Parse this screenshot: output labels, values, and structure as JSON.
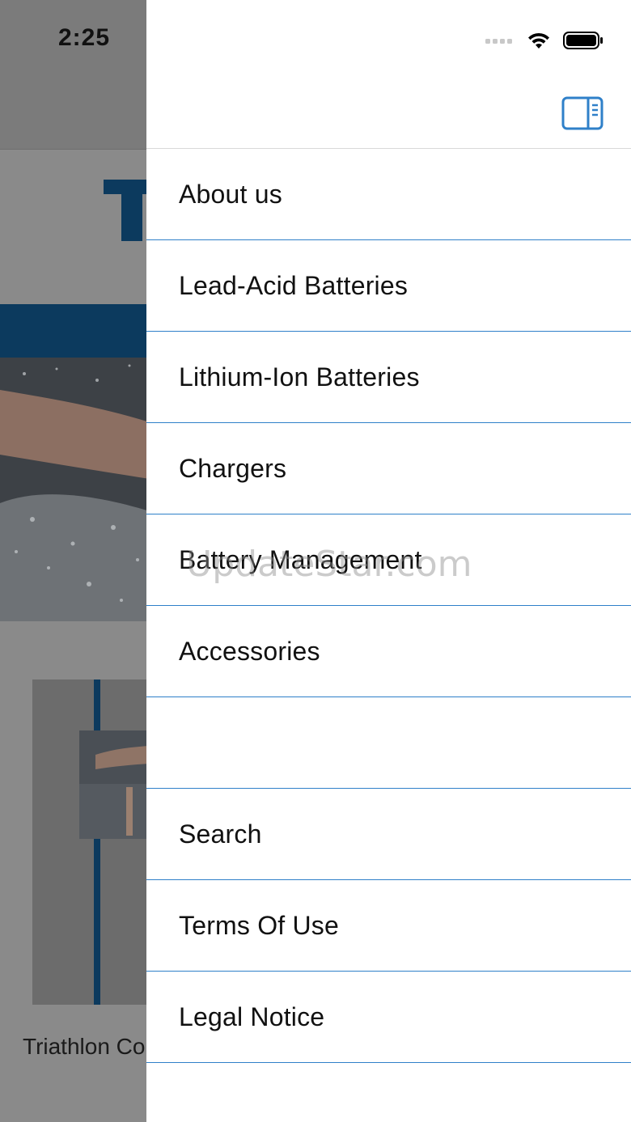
{
  "status_bar": {
    "time": "2:25"
  },
  "background_page": {
    "caption": "Triathlon Cor"
  },
  "drawer": {
    "toggle_icon": "sidebar-toggle-icon",
    "menu": [
      {
        "label": "About us"
      },
      {
        "label": "Lead-Acid Batteries"
      },
      {
        "label": "Lithium-Ion Batteries"
      },
      {
        "label": "Chargers"
      },
      {
        "label": "Battery Management"
      },
      {
        "label": "Accessories"
      },
      {
        "label": ""
      },
      {
        "label": "Search"
      },
      {
        "label": "Terms Of Use"
      },
      {
        "label": "Legal Notice"
      }
    ]
  },
  "watermark": "UpdateStar.com",
  "colors": {
    "accent": "#2f80c9",
    "brand_dark": "#0c3a5e",
    "overlay": "#7b7b7b"
  }
}
